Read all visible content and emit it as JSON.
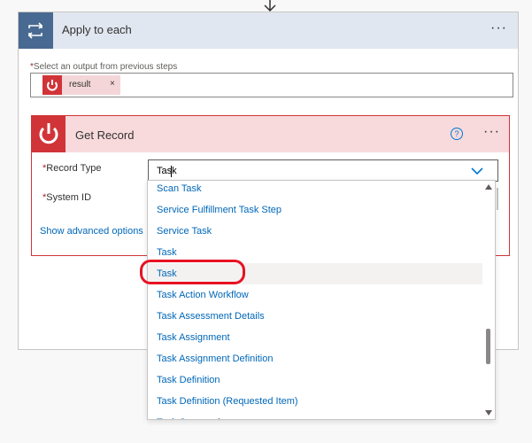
{
  "loop": {
    "title": "Apply to each",
    "more": "···",
    "select_label": "Select an output from previous steps",
    "required_mark": "*",
    "token": {
      "label": "result",
      "remove": "×"
    }
  },
  "action": {
    "title": "Get Record",
    "help": "?",
    "more": "···",
    "fields": {
      "record_type": {
        "label": "Record Type",
        "value": "Task"
      },
      "system_id": {
        "label": "System ID"
      }
    },
    "advanced_link": "Show advanced options"
  },
  "dropdown": {
    "items": [
      "Scan Task",
      "Service Fulfillment Task Step",
      "Service Task",
      "Task",
      "Task",
      "Task Action Workflow",
      "Task Assessment Details",
      "Task Assignment",
      "Task Assignment Definition",
      "Task Definition",
      "Task Definition (Requested Item)",
      "Task Sequencing"
    ],
    "highlighted_index": 4
  },
  "colors": {
    "loop_accent": "#486991",
    "servicenow_red": "#d13438",
    "link_blue": "#0067b8",
    "annotation_red": "#e81123"
  }
}
